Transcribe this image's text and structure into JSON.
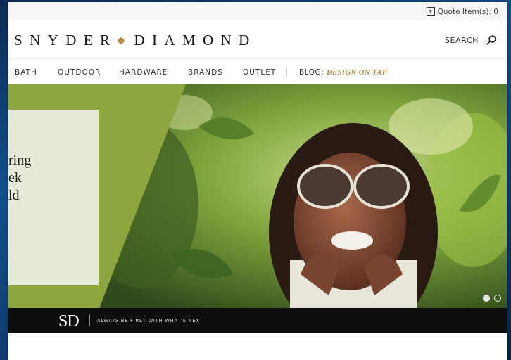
{
  "topbar": {
    "quote_icon": "$",
    "quote_label": "Quote Item(s): 0"
  },
  "header": {
    "logo_left": "SNYDER",
    "logo_right": "DIAMOND",
    "search_label": "SEARCH"
  },
  "nav": {
    "items": [
      "BATH",
      "OUTDOOR",
      "HARDWARE",
      "BRANDS",
      "OUTLET"
    ],
    "blog_label": "BLOG:",
    "blog_accent": "DESIGN ON TAP"
  },
  "hero": {
    "text_lines": [
      "ring",
      "ek",
      "ld"
    ],
    "slides": 2,
    "active_slide": 1
  },
  "banner": {
    "mark": "SD",
    "tagline": "ALWAYS BE FIRST WITH WHAT'S NEXT"
  },
  "colors": {
    "accent_gold": "#b08a4a",
    "hero_green": "#8da63e",
    "panel_cream": "#e6ead8"
  }
}
